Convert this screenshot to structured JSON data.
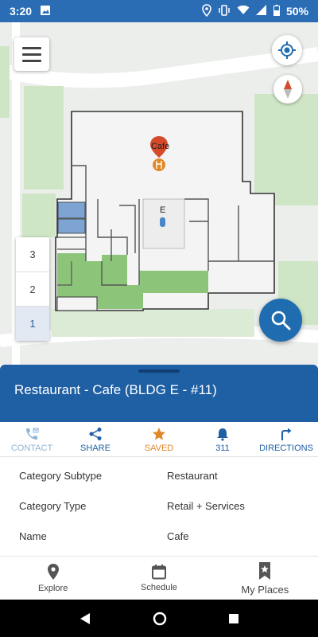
{
  "status_bar": {
    "time": "3:20",
    "battery": "50%"
  },
  "map": {
    "poi_label": "Cafe",
    "building_label": "E",
    "floors": [
      "3",
      "2",
      "1"
    ],
    "active_floor": "1"
  },
  "place": {
    "title": "Restaurant - Cafe (BLDG E - #11)"
  },
  "actions": [
    {
      "label": "CONTACT",
      "icon": "phone-icon",
      "color": "#8fb4d8"
    },
    {
      "label": "SHARE",
      "icon": "share-icon",
      "color": "#1f5fa4"
    },
    {
      "label": "SAVED",
      "icon": "star-icon",
      "color": "#e0872a"
    },
    {
      "label": "311",
      "icon": "bell-icon",
      "color": "#1f5fa4"
    },
    {
      "label": "DIRECTIONS",
      "icon": "turn-right-icon",
      "color": "#1f5fa4"
    }
  ],
  "details": [
    {
      "key": "Category Subtype",
      "value": "Restaurant"
    },
    {
      "key": "Category Type",
      "value": "Retail + Services"
    },
    {
      "key": "Name",
      "value": "Cafe"
    }
  ],
  "bottom_nav": [
    {
      "label": "Explore",
      "icon": "location-pin-icon"
    },
    {
      "label": "Schedule",
      "icon": "calendar-icon"
    },
    {
      "label": "My Places",
      "icon": "bookmark-star-icon"
    }
  ],
  "colors": {
    "accent": "#1f5fa4",
    "saved": "#e0872a",
    "poi_red": "#d64a2c",
    "green_area": "#8cc57a"
  }
}
